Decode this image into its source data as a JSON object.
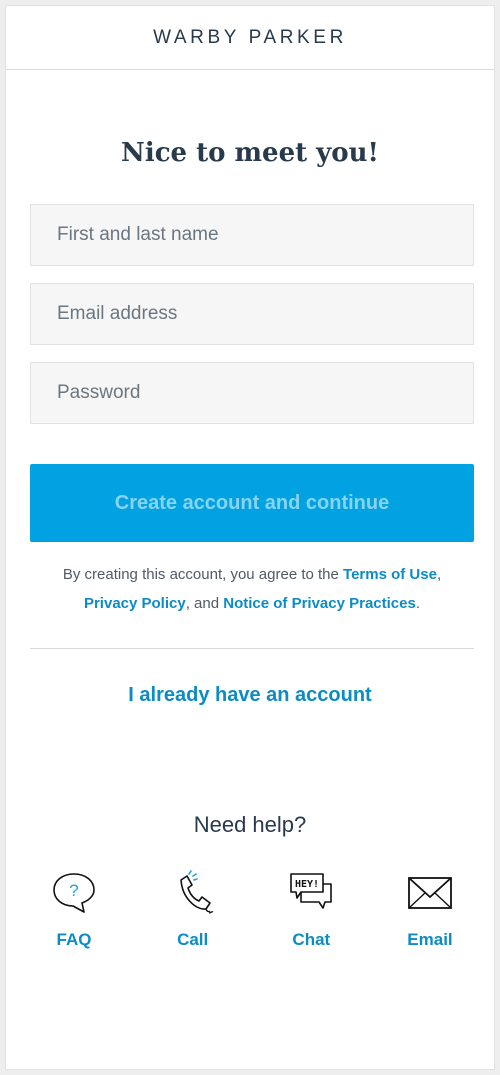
{
  "header": {
    "logo": "WARBY PARKER"
  },
  "form": {
    "title": "Nice to meet you!",
    "name_placeholder": "First and last name",
    "email_placeholder": "Email address",
    "password_placeholder": "Password",
    "submit_label": "Create account and continue"
  },
  "terms": {
    "prefix": "By creating this account, you agree to the ",
    "terms_link": "Terms of Use",
    "sep1": ",",
    "privacy_link": "Privacy Policy",
    "sep2": ", and ",
    "notice_link": "Notice of Privacy Practices",
    "suffix": "."
  },
  "signin_link": "I already have an account",
  "help": {
    "title": "Need help?",
    "items": [
      {
        "label": "FAQ",
        "icon": "faq-bubble-icon"
      },
      {
        "label": "Call",
        "icon": "phone-icon"
      },
      {
        "label": "Chat",
        "icon": "chat-hey-icon"
      },
      {
        "label": "Email",
        "icon": "envelope-icon"
      }
    ],
    "faq_glyph": "?",
    "chat_glyph": "HEY!"
  },
  "colors": {
    "accent": "#00a2e1",
    "link": "#0c8cc4",
    "text": "#283a4b"
  }
}
